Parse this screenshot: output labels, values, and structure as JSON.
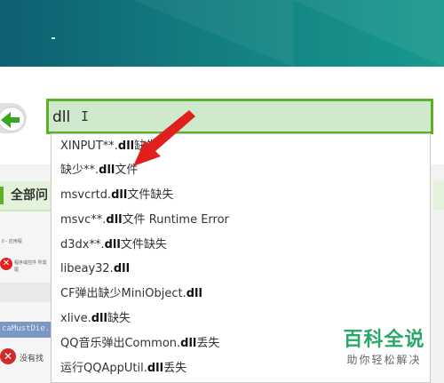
{
  "search": {
    "query": "dll"
  },
  "suggestions": [
    {
      "pre": "XINPUT**.",
      "bold": "dll",
      "post": "缺失"
    },
    {
      "pre": "缺少**.",
      "bold": "dll",
      "post": "文件"
    },
    {
      "pre": "msvcrtd.",
      "bold": "dll",
      "post": "文件缺失"
    },
    {
      "pre": "msvc**.",
      "bold": "dll",
      "post": "文件 Runtime Error"
    },
    {
      "pre": "d3dx**.",
      "bold": "dll",
      "post": "文件缺失"
    },
    {
      "pre": "libeay32.",
      "bold": "dll",
      "post": ""
    },
    {
      "pre": "CF弹出缺少MiniObject.",
      "bold": "dll",
      "post": ""
    },
    {
      "pre": "xlive.",
      "bold": "dll",
      "post": "缺失"
    },
    {
      "pre": "QQ音乐弹出Common.",
      "bold": "dll",
      "post": "丢失"
    },
    {
      "pre": "运行QQAppUtil.",
      "bold": "dll",
      "post": "丢失"
    }
  ],
  "sidebar": {
    "tab_label": "全部问"
  },
  "background": {
    "mini_line_1": "ll - 应用程",
    "mini_line_2": "程序或控件 所需",
    "mini_line_3": "尾",
    "blue_text": "caMustDie.c",
    "bottom_text": "没有找"
  },
  "watermark": {
    "main": "百科全说",
    "sub": "助你轻松解决"
  },
  "colors": {
    "accent_green": "#5cb227",
    "annotation_red": "#e0201c",
    "header_teal": "#137c80",
    "watermark_green": "#2aa86a"
  }
}
